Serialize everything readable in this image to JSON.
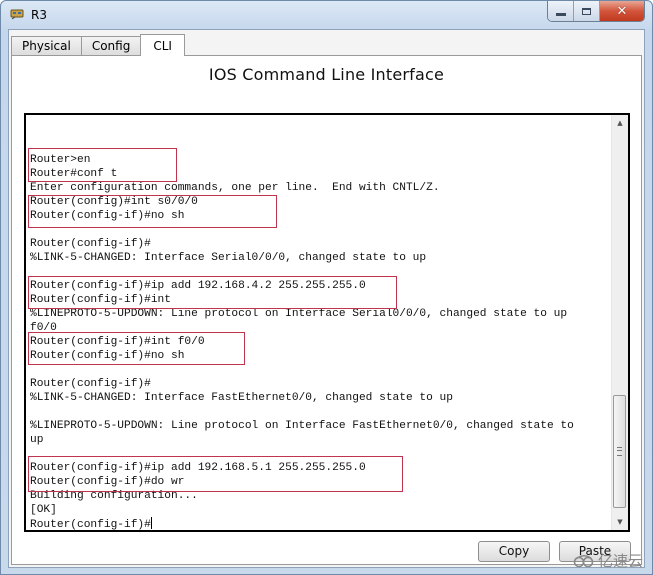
{
  "window": {
    "title": "R3",
    "caption_buttons": {
      "minimize": "minimize",
      "maximize": "maximize",
      "close": "close"
    }
  },
  "tabs": [
    {
      "label": "Physical",
      "active": false
    },
    {
      "label": "Config",
      "active": false
    },
    {
      "label": "CLI",
      "active": true
    }
  ],
  "panel": {
    "title": "IOS Command Line Interface"
  },
  "terminal": {
    "lines": [
      "Router>en",
      "Router#conf t",
      "Enter configuration commands, one per line.  End with CNTL/Z.",
      "Router(config)#int s0/0/0",
      "Router(config-if)#no sh",
      "",
      "Router(config-if)#",
      "%LINK-5-CHANGED: Interface Serial0/0/0, changed state to up",
      "",
      "Router(config-if)#ip add 192.168.4.2 255.255.255.0",
      "Router(config-if)#int",
      "%LINEPROTO-5-UPDOWN: Line protocol on Interface Serial0/0/0, changed state to up",
      "f0/0",
      "Router(config-if)#int f0/0",
      "Router(config-if)#no sh",
      "",
      "Router(config-if)#",
      "%LINK-5-CHANGED: Interface FastEthernet0/0, changed state to up",
      "",
      "%LINEPROTO-5-UPDOWN: Line protocol on Interface FastEthernet0/0, changed state to",
      "up",
      "",
      "Router(config-if)#ip add 192.168.5.1 255.255.255.0",
      "Router(config-if)#do wr",
      "Building configuration...",
      "[OK]",
      "Router(config-if)#"
    ],
    "highlight_color": "#c3334d",
    "scroll_position": "bottom"
  },
  "buttons": {
    "copy": "Copy",
    "paste": "Paste"
  },
  "watermark": {
    "text": "亿速云"
  }
}
